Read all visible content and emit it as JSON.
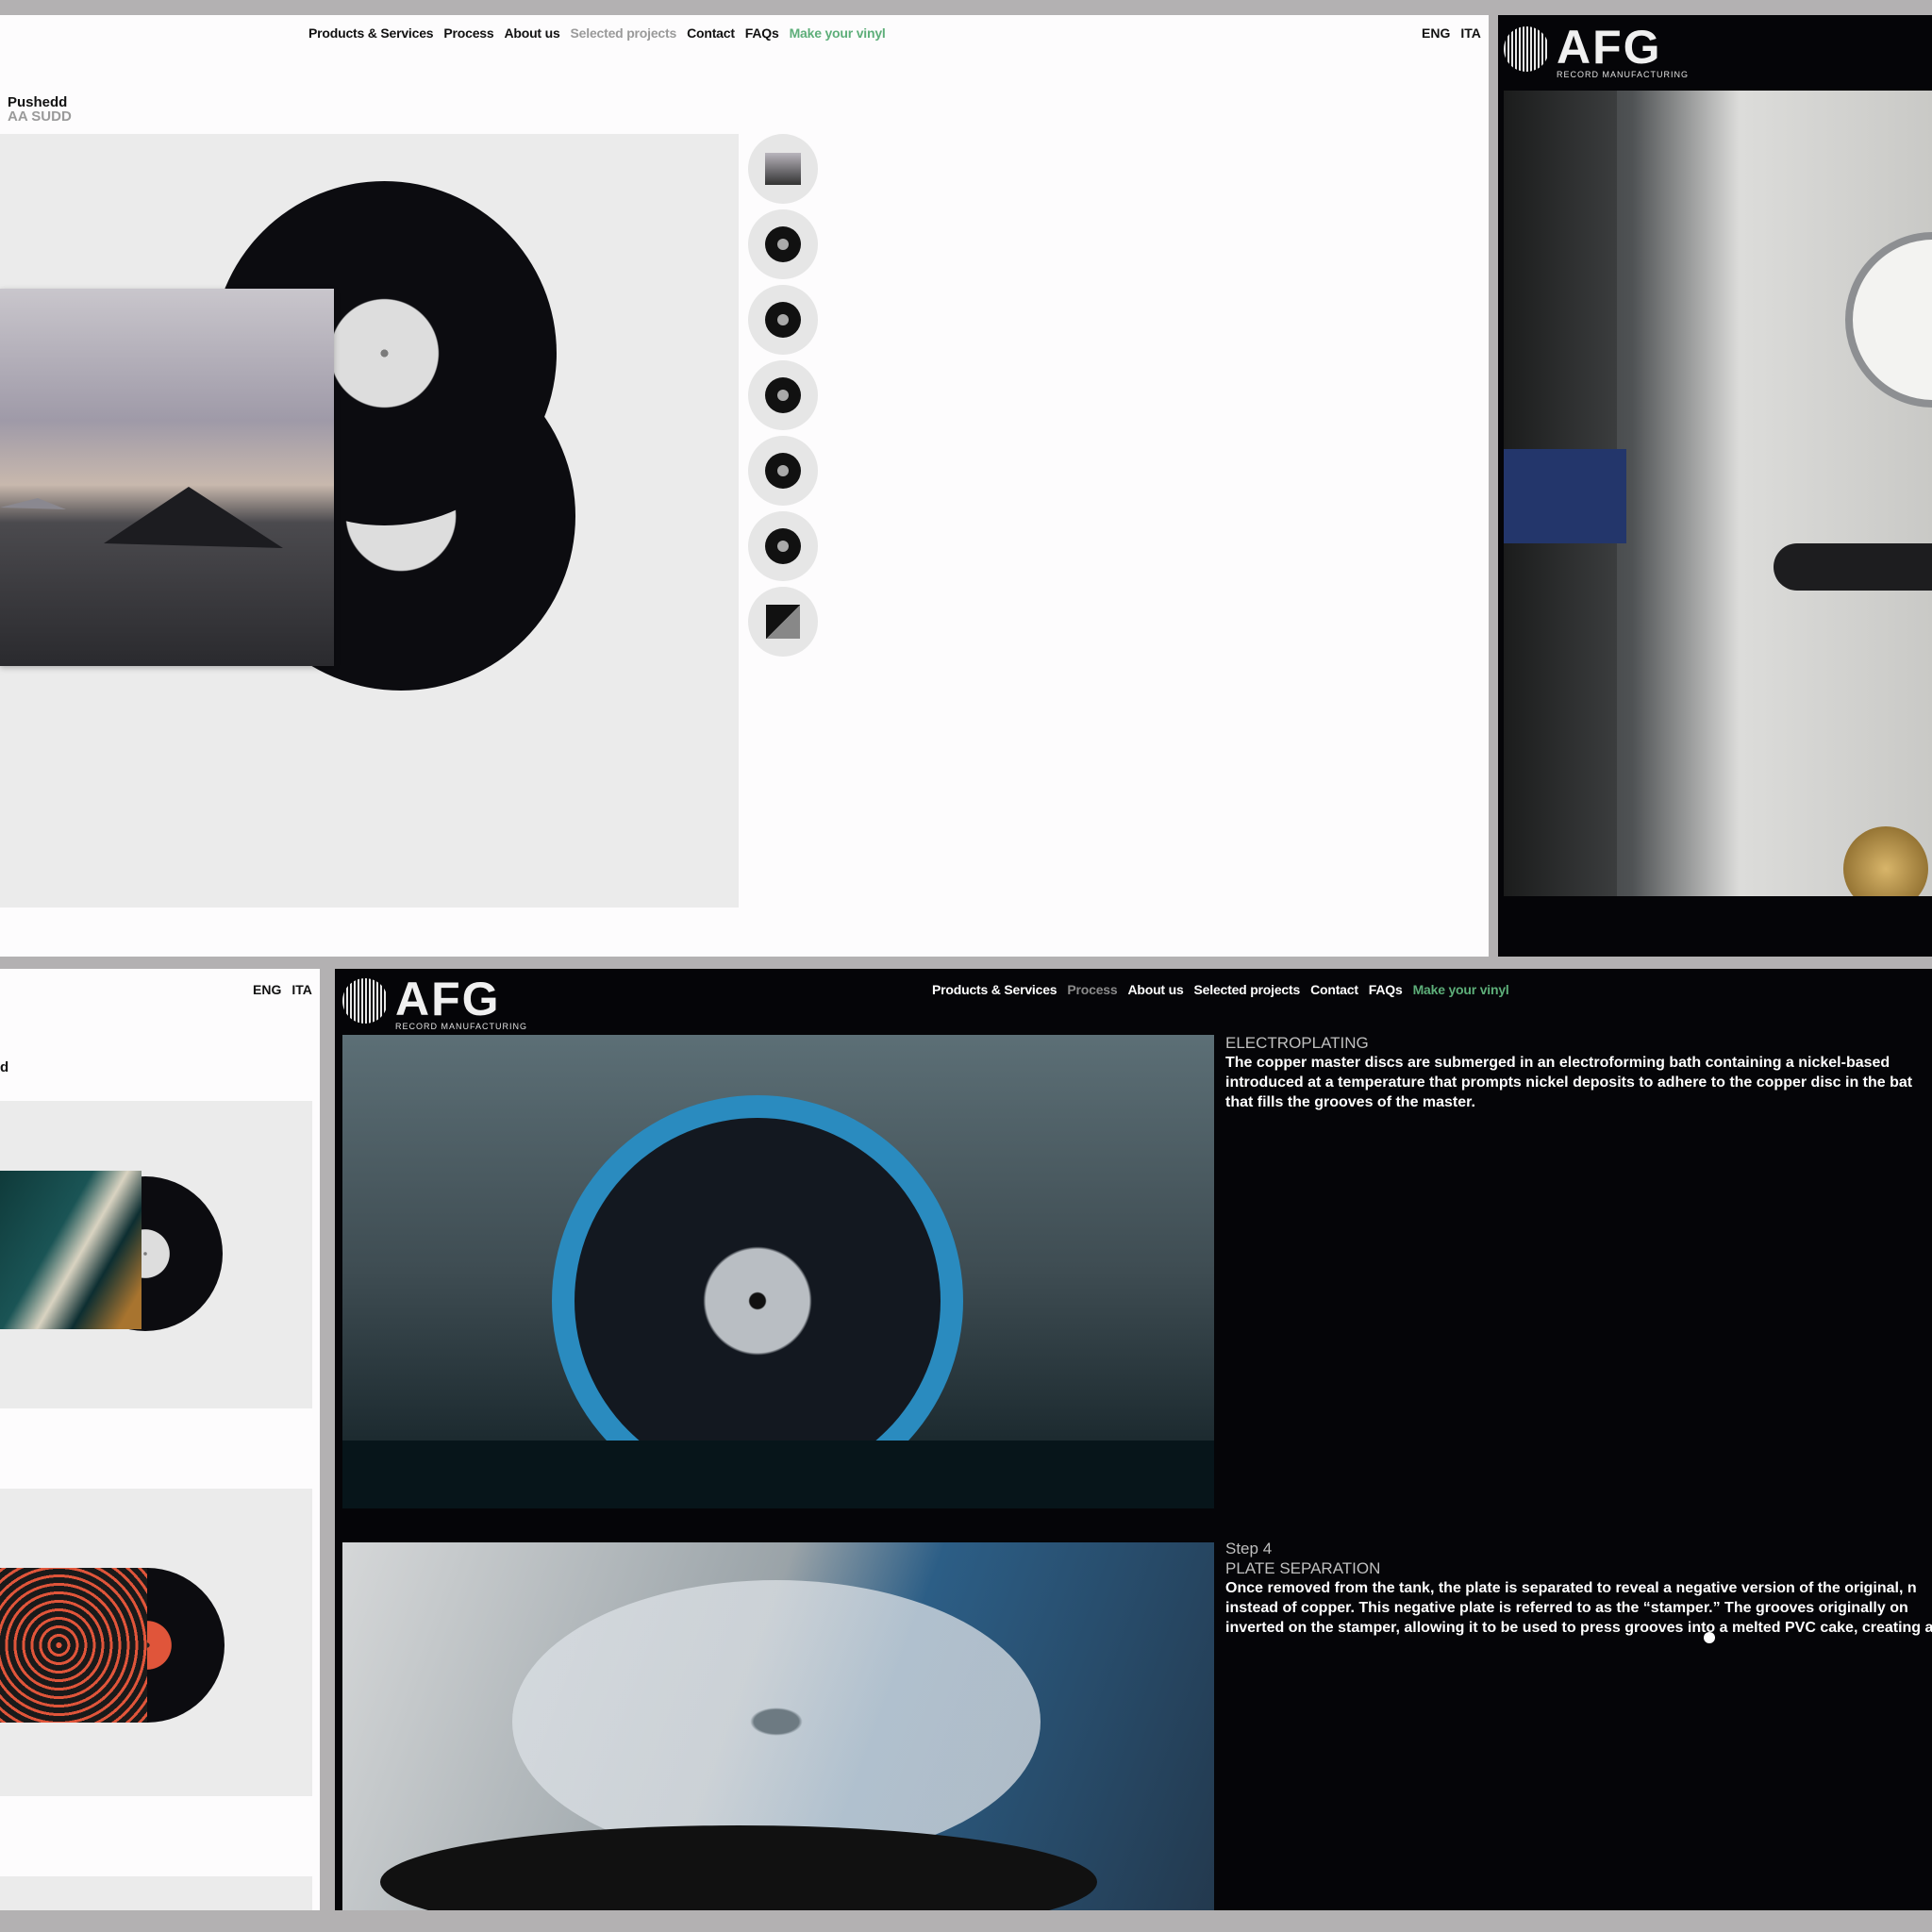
{
  "nav": {
    "products": "Products & Services",
    "process": "Process",
    "about": "About us",
    "projects": "Selected projects",
    "contact": "Contact",
    "faqs": "FAQs",
    "make": "Make your vinyl"
  },
  "lang": {
    "eng": "ENG",
    "ita": "ITA"
  },
  "logo": {
    "word": "AFG",
    "sub": "RECORD MANUFACTURING"
  },
  "project": {
    "artist": "Pushedd",
    "title": "AA SUDD"
  },
  "bottom_left": {
    "fragment": "d"
  },
  "process": {
    "step3_title": "ELECTROPLATING",
    "step3_body": "The copper master discs are submerged in an electroforming bath containing a nickel-based introduced at a temperature that prompts nickel deposits to adhere to the copper disc in the bat that fills the grooves of the master.",
    "step4_label": "Step 4",
    "step4_title": "PLATE SEPARATION",
    "step4_body": "Once removed from the tank, the plate is separated to reveal a negative version of the original, n instead of copper. This negative plate is referred to as the “stamper.” The grooves originally on inverted on the stamper, allowing it to be used to press grooves into a melted PVC cake, creating a"
  },
  "colors": {
    "accent": "#5dae79",
    "muted": "#9a9a9a",
    "dark": "#050508"
  }
}
